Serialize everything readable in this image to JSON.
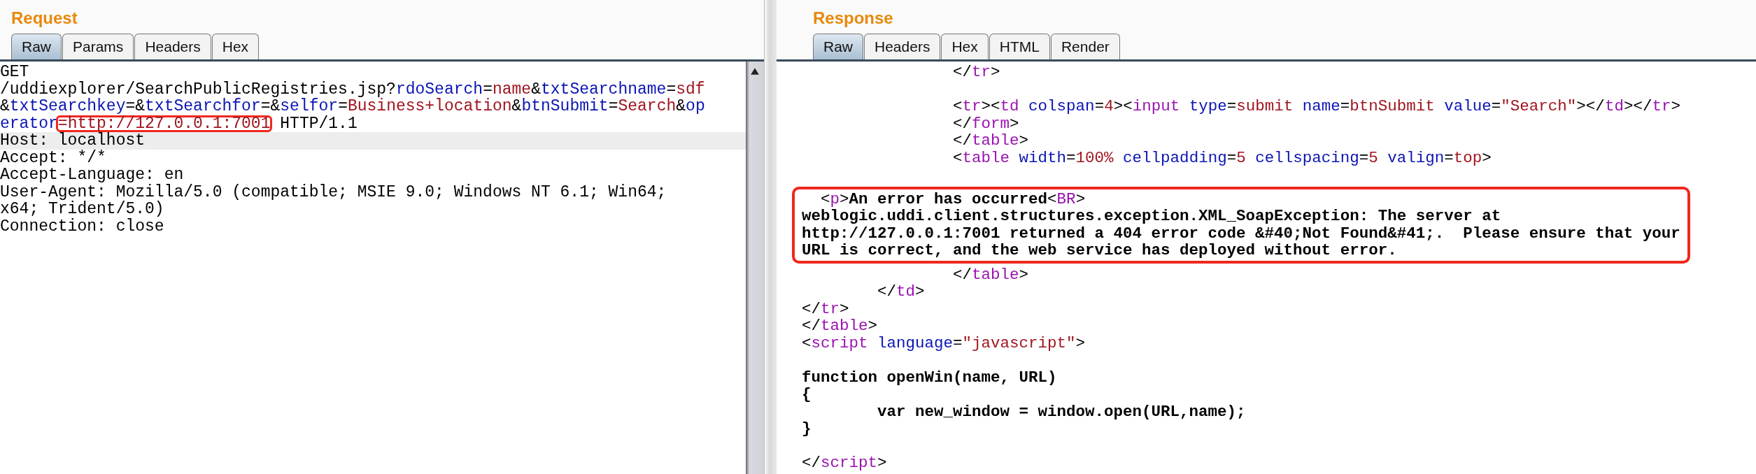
{
  "request": {
    "title": "Request",
    "tabs": [
      {
        "label": "Raw",
        "selected": true
      },
      {
        "label": "Params",
        "selected": false
      },
      {
        "label": "Headers",
        "selected": false
      },
      {
        "label": "Hex",
        "selected": false
      }
    ],
    "lines": [
      {
        "highlighted": false,
        "tokens": [
          {
            "kind": "plain",
            "text": "GET"
          }
        ]
      },
      {
        "highlighted": false,
        "tokens": [
          {
            "kind": "plain",
            "text": "/uddiexplorer/SearchPublicRegistries.jsp?"
          },
          {
            "kind": "attr",
            "text": "rdoSearch"
          },
          {
            "kind": "plain",
            "text": "="
          },
          {
            "kind": "val",
            "text": "name"
          },
          {
            "kind": "plain",
            "text": "&"
          },
          {
            "kind": "attr",
            "text": "txtSearchname"
          },
          {
            "kind": "plain",
            "text": "="
          },
          {
            "kind": "val",
            "text": "sdf"
          }
        ]
      },
      {
        "highlighted": false,
        "tokens": [
          {
            "kind": "plain",
            "text": "&"
          },
          {
            "kind": "attr",
            "text": "txtSearchkey"
          },
          {
            "kind": "plain",
            "text": "=&"
          },
          {
            "kind": "attr",
            "text": "txtSearchfor"
          },
          {
            "kind": "plain",
            "text": "=&"
          },
          {
            "kind": "attr",
            "text": "selfor"
          },
          {
            "kind": "plain",
            "text": "="
          },
          {
            "kind": "val",
            "text": "Business+location"
          },
          {
            "kind": "plain",
            "text": "&"
          },
          {
            "kind": "attr",
            "text": "btnSubmit"
          },
          {
            "kind": "plain",
            "text": "="
          },
          {
            "kind": "val",
            "text": "Search"
          },
          {
            "kind": "plain",
            "text": "&"
          },
          {
            "kind": "attr",
            "text": "op"
          }
        ]
      },
      {
        "highlighted": false,
        "tokens": [
          {
            "kind": "attr",
            "text": "erator"
          },
          {
            "kind": "val",
            "text": "=http://127.0.0.1:7001",
            "boxed": true
          },
          {
            "kind": "plain",
            "text": " HTTP/1.1"
          }
        ]
      },
      {
        "highlighted": true,
        "tokens": [
          {
            "kind": "plain",
            "text": "Host: localhost"
          }
        ]
      },
      {
        "highlighted": false,
        "tokens": [
          {
            "kind": "plain",
            "text": "Accept: */*"
          }
        ]
      },
      {
        "highlighted": false,
        "tokens": [
          {
            "kind": "plain",
            "text": "Accept-Language: en"
          }
        ]
      },
      {
        "highlighted": false,
        "tokens": [
          {
            "kind": "plain",
            "text": "User-Agent: Mozilla/5.0 (compatible; MSIE 9.0; Windows NT 6.1; Win64;"
          }
        ]
      },
      {
        "highlighted": false,
        "tokens": [
          {
            "kind": "plain",
            "text": "x64; Trident/5.0)"
          }
        ]
      },
      {
        "highlighted": false,
        "tokens": [
          {
            "kind": "plain",
            "text": "Connection: close"
          }
        ]
      }
    ]
  },
  "response": {
    "title": "Response",
    "tabs": [
      {
        "label": "Raw",
        "selected": true
      },
      {
        "label": "Headers",
        "selected": false
      },
      {
        "label": "Hex",
        "selected": false
      },
      {
        "label": "HTML",
        "selected": false
      },
      {
        "label": "Render",
        "selected": false
      }
    ],
    "blocks": [
      {
        "boxed": false,
        "lines": [
          {
            "blank_before": false,
            "tokens": [
              {
                "kind": "plain",
                "text": "                </"
              },
              {
                "kind": "tag",
                "text": "tr"
              },
              {
                "kind": "plain",
                "text": ">"
              }
            ]
          },
          {
            "blank_before": true,
            "tokens": [
              {
                "kind": "plain",
                "text": "                <"
              },
              {
                "kind": "tag",
                "text": "tr"
              },
              {
                "kind": "plain",
                "text": "><"
              },
              {
                "kind": "tag",
                "text": "td"
              },
              {
                "kind": "attr",
                "text": " colspan"
              },
              {
                "kind": "plain",
                "text": "="
              },
              {
                "kind": "val",
                "text": "4"
              },
              {
                "kind": "plain",
                "text": "><"
              },
              {
                "kind": "tag",
                "text": "input"
              },
              {
                "kind": "attr",
                "text": " type"
              },
              {
                "kind": "plain",
                "text": "="
              },
              {
                "kind": "val",
                "text": "submit"
              },
              {
                "kind": "attr",
                "text": " name"
              },
              {
                "kind": "plain",
                "text": "="
              },
              {
                "kind": "val",
                "text": "btnSubmit"
              },
              {
                "kind": "attr",
                "text": " value"
              },
              {
                "kind": "plain",
                "text": "="
              },
              {
                "kind": "val",
                "text": "\"Search\""
              },
              {
                "kind": "plain",
                "text": "></"
              },
              {
                "kind": "tag",
                "text": "td"
              },
              {
                "kind": "plain",
                "text": "></"
              },
              {
                "kind": "tag",
                "text": "tr"
              },
              {
                "kind": "plain",
                "text": ">"
              }
            ]
          },
          {
            "blank_before": false,
            "tokens": [
              {
                "kind": "plain",
                "text": "                </"
              },
              {
                "kind": "tag",
                "text": "form"
              },
              {
                "kind": "plain",
                "text": ">"
              }
            ]
          },
          {
            "blank_before": false,
            "tokens": [
              {
                "kind": "plain",
                "text": "                </"
              },
              {
                "kind": "tag",
                "text": "table"
              },
              {
                "kind": "plain",
                "text": ">"
              }
            ]
          },
          {
            "blank_before": false,
            "tokens": [
              {
                "kind": "plain",
                "text": "                <"
              },
              {
                "kind": "tag",
                "text": "table"
              },
              {
                "kind": "attr",
                "text": " width"
              },
              {
                "kind": "plain",
                "text": "="
              },
              {
                "kind": "val",
                "text": "100%"
              },
              {
                "kind": "attr",
                "text": " cellpadding"
              },
              {
                "kind": "plain",
                "text": "="
              },
              {
                "kind": "val",
                "text": "5"
              },
              {
                "kind": "attr",
                "text": " cellspacing"
              },
              {
                "kind": "plain",
                "text": "="
              },
              {
                "kind": "val",
                "text": "5"
              },
              {
                "kind": "attr",
                "text": " valign"
              },
              {
                "kind": "plain",
                "text": "="
              },
              {
                "kind": "val",
                "text": "top"
              },
              {
                "kind": "plain",
                "text": ">"
              }
            ]
          }
        ]
      },
      {
        "boxed": true,
        "lines": [
          {
            "blank_before": false,
            "tokens": [
              {
                "kind": "plain",
                "text": "  <"
              },
              {
                "kind": "tag",
                "text": "p"
              },
              {
                "kind": "plain",
                "text": ">"
              },
              {
                "kind": "bold",
                "text": "An error has occurred"
              },
              {
                "kind": "plain",
                "text": "<"
              },
              {
                "kind": "tag",
                "text": "BR"
              },
              {
                "kind": "plain",
                "text": ">"
              }
            ]
          },
          {
            "blank_before": false,
            "tokens": [
              {
                "kind": "bold",
                "text": "weblogic.uddi.client.structures.exception.XML_SoapException: The server at"
              }
            ]
          },
          {
            "blank_before": false,
            "tokens": [
              {
                "kind": "bold",
                "text": "http://127.0.0.1:7001 returned a 404 error code &#40;Not Found&#41;.  Please ensure that your"
              }
            ]
          },
          {
            "blank_before": false,
            "tokens": [
              {
                "kind": "bold",
                "text": "URL is correct, and the web service has deployed without error."
              }
            ]
          }
        ]
      },
      {
        "boxed": false,
        "lines": [
          {
            "blank_before": false,
            "tokens": [
              {
                "kind": "plain",
                "text": "                </"
              },
              {
                "kind": "tag",
                "text": "table"
              },
              {
                "kind": "plain",
                "text": ">"
              }
            ]
          },
          {
            "blank_before": false,
            "tokens": [
              {
                "kind": "plain",
                "text": "        </"
              },
              {
                "kind": "tag",
                "text": "td"
              },
              {
                "kind": "plain",
                "text": ">"
              }
            ]
          },
          {
            "blank_before": false,
            "tokens": [
              {
                "kind": "plain",
                "text": "</"
              },
              {
                "kind": "tag",
                "text": "tr"
              },
              {
                "kind": "plain",
                "text": ">"
              }
            ]
          },
          {
            "blank_before": false,
            "tokens": [
              {
                "kind": "plain",
                "text": "</"
              },
              {
                "kind": "tag",
                "text": "table"
              },
              {
                "kind": "plain",
                "text": ">"
              }
            ]
          },
          {
            "blank_before": false,
            "tokens": [
              {
                "kind": "plain",
                "text": "<"
              },
              {
                "kind": "tag",
                "text": "script"
              },
              {
                "kind": "attr",
                "text": " language"
              },
              {
                "kind": "plain",
                "text": "="
              },
              {
                "kind": "val",
                "text": "\"javascript\""
              },
              {
                "kind": "plain",
                "text": ">"
              }
            ]
          },
          {
            "blank_before": true,
            "tokens": [
              {
                "kind": "bold",
                "text": "function openWin(name, URL)"
              }
            ]
          },
          {
            "blank_before": false,
            "tokens": [
              {
                "kind": "bold",
                "text": "{"
              }
            ]
          },
          {
            "blank_before": false,
            "tokens": [
              {
                "kind": "bold",
                "text": "        var new_window = window.open(URL,name);"
              }
            ]
          },
          {
            "blank_before": false,
            "tokens": [
              {
                "kind": "bold",
                "text": "}"
              }
            ]
          },
          {
            "blank_before": true,
            "tokens": [
              {
                "kind": "plain",
                "text": "</"
              },
              {
                "kind": "tag",
                "text": "script"
              },
              {
                "kind": "plain",
                "text": ">"
              }
            ]
          }
        ]
      }
    ]
  }
}
